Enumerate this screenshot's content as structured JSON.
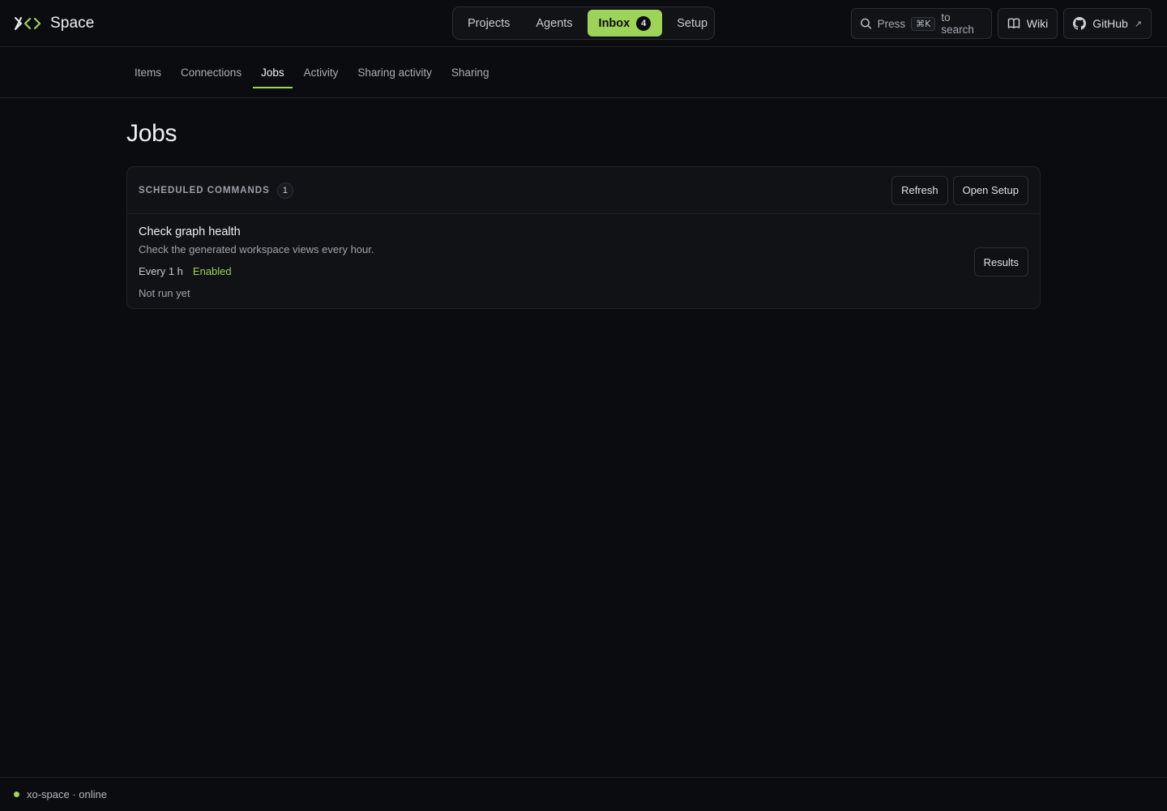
{
  "brand": {
    "name": "Space",
    "accent": "#9ed35a"
  },
  "main_nav": [
    {
      "label": "Projects",
      "active": false
    },
    {
      "label": "Agents",
      "active": false
    },
    {
      "label": "Inbox",
      "active": true,
      "badge": "4"
    },
    {
      "label": "Setup",
      "active": false
    }
  ],
  "search": {
    "prefix": "Press",
    "shortcut": "⌘K",
    "suffix": "to search",
    "icon": "search-icon"
  },
  "links": {
    "wiki": {
      "label": "Wiki",
      "icon": "book-icon"
    },
    "github": {
      "label": "GitHub",
      "icon": "github-icon",
      "external": "↗"
    }
  },
  "tabs": [
    {
      "label": "Items",
      "active": false
    },
    {
      "label": "Connections",
      "active": false
    },
    {
      "label": "Jobs",
      "active": true
    },
    {
      "label": "Activity",
      "active": false
    },
    {
      "label": "Sharing activity",
      "active": false
    },
    {
      "label": "Sharing",
      "active": false
    }
  ],
  "page": {
    "title": "Jobs"
  },
  "scheduled": {
    "label": "SCHEDULED COMMANDS",
    "count": "1",
    "refresh_label": "Refresh",
    "open_setup_label": "Open Setup",
    "jobs": [
      {
        "name": "Check graph health",
        "description": "Check the generated workspace views every hour.",
        "interval": "Every 1 h",
        "status": "Enabled",
        "last_run": "Not run yet",
        "results_label": "Results"
      }
    ]
  },
  "footer": {
    "status_text": "xo-space · online",
    "status_color": "#9ed35a"
  }
}
